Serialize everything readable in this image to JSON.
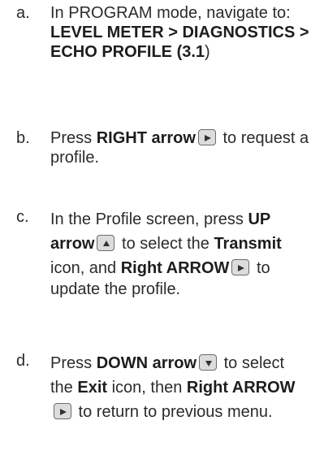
{
  "steps": [
    {
      "letter": "a.",
      "text1": "In PROGRAM mode, navigate to:",
      "bold_path1": "LEVEL METER > DIAGNOSTICS >",
      "bold_path2": "ECHO PROFILE (3.1",
      "close_paren": ")"
    },
    {
      "letter": "b.",
      "t1": "Press ",
      "b1": "RIGHT arrow",
      "key1": "right-arrow-key-icon",
      "t2": " to request a",
      "t3": "profile."
    },
    {
      "letter": "c.",
      "t1": "In the Profile screen, press ",
      "b1": "UP",
      "b2": "arrow",
      "key1": "up-arrow-key-icon",
      "t2": " to select the ",
      "b3": "Transmit",
      "t3": "icon, and ",
      "b4": "Right ARROW",
      "key2": "right-arrow-key-icon",
      "t4": " to",
      "t5": "update the profile."
    },
    {
      "letter": "d.",
      "t1": "Press ",
      "b1": "DOWN arrow",
      "key1": "down-arrow-key-icon",
      "t2": " to select",
      "t3": "the ",
      "b2": "Exit",
      "t4": " icon, then ",
      "b3": "Right ARROW",
      "key2": "right-arrow-key-icon",
      "t5": " to return to previous menu."
    }
  ]
}
